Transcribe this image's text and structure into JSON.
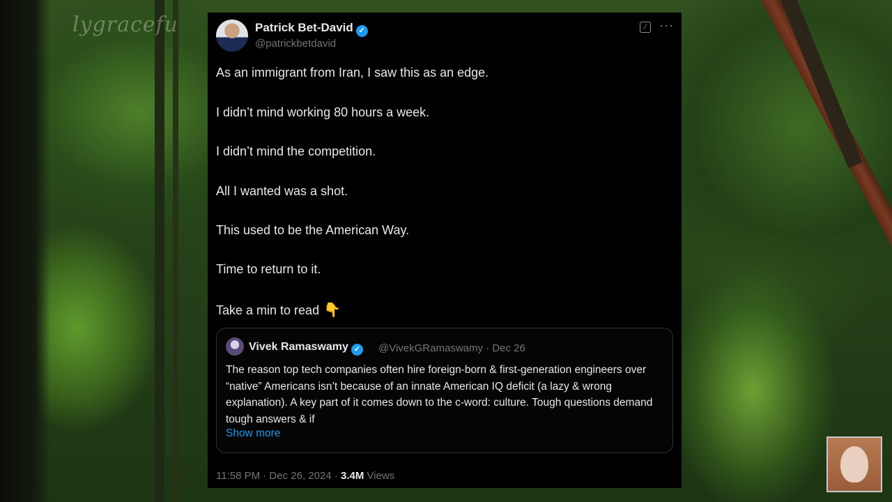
{
  "background": {
    "watermark": "lygracefu"
  },
  "tweet": {
    "author_name": "Patrick Bet-David",
    "handle": "@patrickbetdavid",
    "lines": [
      "As an immigrant from Iran, I saw this as an edge.",
      "I didn’t mind working 80 hours a week.",
      "I didn’t mind the competition.",
      "All I wanted was a shot.",
      "This used to be the American Way.",
      "Time to return to it.",
      "Take a min to read"
    ],
    "emoji": "👇",
    "quote": {
      "author_name": "Vivek Ramaswamy",
      "meta": "@VivekGRamaswamy · Dec 26",
      "text": "The reason top tech companies often hire foreign-born & first-generation engineers over “native” Americans isn’t because of an innate American IQ deficit (a lazy & wrong explanation). A key part of it comes down to the c-word: culture. Tough questions demand tough answers & if",
      "show_more": "Show more"
    },
    "timestamp": "11:58 PM · Dec 26, 2024 · ",
    "views_count": "3.4M",
    "views_label": " Views"
  },
  "colors": {
    "verified": "#1d9bf0",
    "link": "#1d9bf0",
    "card_bg": "#000000",
    "muted_text": "#71767b"
  },
  "icons": [
    "verified-badge-icon",
    "grok-icon",
    "more-options-icon",
    "backhand-index-pointing-down-icon"
  ]
}
